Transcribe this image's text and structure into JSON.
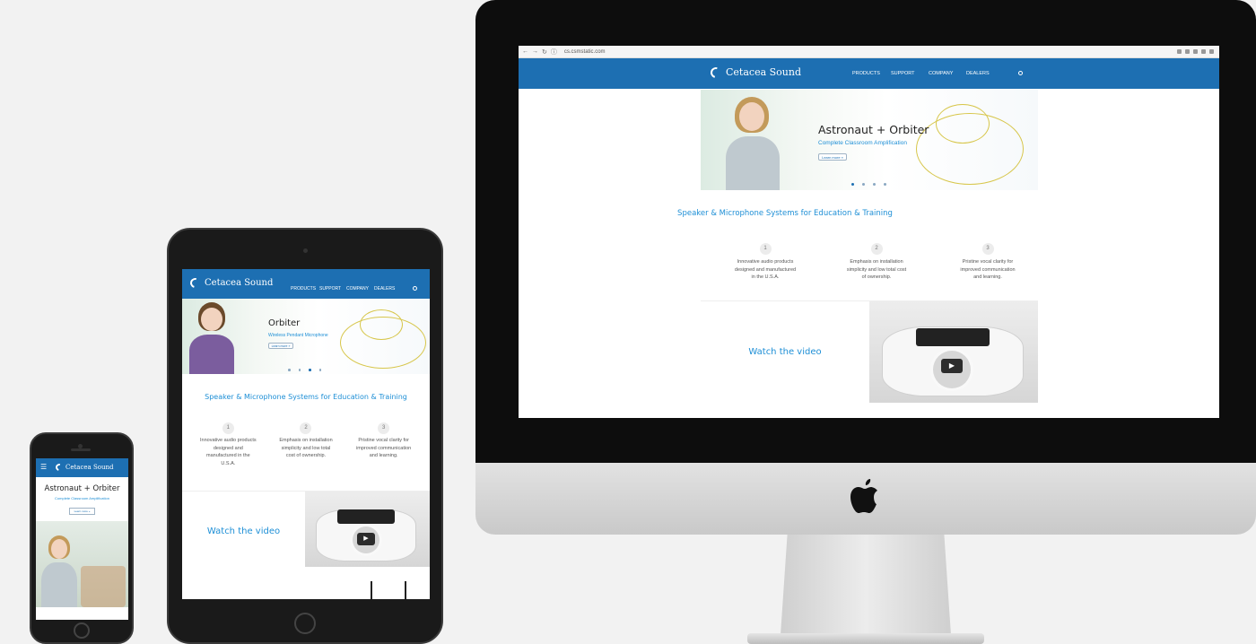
{
  "desktop": {
    "browser": {
      "url": "cs.csmstatic.com"
    },
    "brand": "Cetacea Sound",
    "nav": [
      "PRODUCTS",
      "SUPPORT",
      "COMPANY",
      "DEALERS"
    ],
    "hero": {
      "title": "Astronaut + Orbiter",
      "subtitle": "Complete Classroom Amplification",
      "button": "Learn more »"
    },
    "tagline": "Speaker & Microphone Systems for Education & Training",
    "features": [
      {
        "num": "1",
        "text": "Innovative audio products designed and manufactured in the U.S.A."
      },
      {
        "num": "2",
        "text": "Emphasis on installation simplicity and low total cost of ownership."
      },
      {
        "num": "3",
        "text": "Pristine vocal clarity for improved communication and learning."
      }
    ],
    "video": {
      "label": "Watch the video"
    }
  },
  "tablet": {
    "brand": "Cetacea Sound",
    "nav": [
      "PRODUCTS",
      "SUPPORT",
      "COMPANY",
      "DEALERS"
    ],
    "hero": {
      "title": "Orbiter",
      "subtitle": "Wireless Pendant Microphone",
      "button": "Learn more »"
    },
    "tagline": "Speaker & Microphone Systems for Education & Training",
    "features": [
      {
        "num": "1",
        "text": "Innovative audio products designed and manufactured in the U.S.A."
      },
      {
        "num": "2",
        "text": "Emphasis on installation simplicity and low total cost of ownership."
      },
      {
        "num": "3",
        "text": "Pristine vocal clarity for improved communication and learning."
      }
    ],
    "video": {
      "label": "Watch the video"
    }
  },
  "phone": {
    "brand": "Cetacea Sound",
    "hero": {
      "title": "Astronaut + Orbiter",
      "subtitle": "Complete Classroom Amplification",
      "button": "Learn more »"
    }
  },
  "colors": {
    "brand_blue": "#1d6fb2",
    "link_blue": "#1e8fd6"
  },
  "icons": [
    "apple-logo-icon",
    "search-icon",
    "menu-icon",
    "play-icon"
  ]
}
